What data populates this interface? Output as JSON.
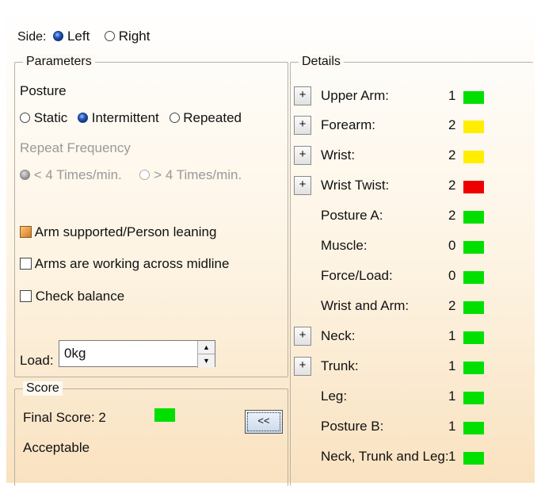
{
  "side": {
    "label": "Side:",
    "options": [
      {
        "label": "Left",
        "selected": true
      },
      {
        "label": "Right",
        "selected": false
      }
    ]
  },
  "parameters": {
    "title": "Parameters",
    "posture_label": "Posture",
    "posture_options": [
      {
        "label": "Static",
        "selected": false
      },
      {
        "label": "Intermittent",
        "selected": true
      },
      {
        "label": "Repeated",
        "selected": false
      }
    ],
    "repeat_label": "Repeat Frequency",
    "repeat_options": [
      {
        "label": "< 4 Times/min.",
        "selected": true,
        "enabled": false
      },
      {
        "label": "> 4 Times/min.",
        "selected": false,
        "enabled": false
      }
    ],
    "checkboxes": [
      {
        "label": "Arm supported/Person leaning",
        "checked": true
      },
      {
        "label": "Arms are working across midline",
        "checked": false
      },
      {
        "label": "Check balance",
        "checked": false
      }
    ],
    "load_label": "Load:",
    "load_value": "0kg"
  },
  "score": {
    "title": "Score",
    "final_label": "Final Score: 2",
    "final_color": "#00e000",
    "status": "Acceptable",
    "collapse_button": "<<"
  },
  "details": {
    "title": "Details",
    "expand_label": "+",
    "rows": [
      {
        "label": "Upper Arm:",
        "value": "1",
        "color": "#00e000",
        "expandable": true
      },
      {
        "label": "Forearm:",
        "value": "2",
        "color": "#ffee00",
        "expandable": true
      },
      {
        "label": "Wrist:",
        "value": "2",
        "color": "#ffee00",
        "expandable": true
      },
      {
        "label": "Wrist Twist:",
        "value": "2",
        "color": "#ee0000",
        "expandable": true
      },
      {
        "label": "Posture A:",
        "value": "2",
        "color": "#00e000",
        "expandable": false
      },
      {
        "label": "Muscle:",
        "value": "0",
        "color": "#00e000",
        "expandable": false
      },
      {
        "label": "Force/Load:",
        "value": "0",
        "color": "#00e000",
        "expandable": false
      },
      {
        "label": "Wrist and Arm:",
        "value": "2",
        "color": "#00e000",
        "expandable": false
      },
      {
        "label": "Neck:",
        "value": "1",
        "color": "#00e000",
        "expandable": true
      },
      {
        "label": "Trunk:",
        "value": "1",
        "color": "#00e000",
        "expandable": true
      },
      {
        "label": "Leg:",
        "value": "1",
        "color": "#00e000",
        "expandable": false
      },
      {
        "label": "Posture B:",
        "value": "1",
        "color": "#00e000",
        "expandable": false
      },
      {
        "label": "Neck, Trunk and Leg:",
        "value": "1",
        "color": "#00e000",
        "expandable": false
      }
    ]
  }
}
